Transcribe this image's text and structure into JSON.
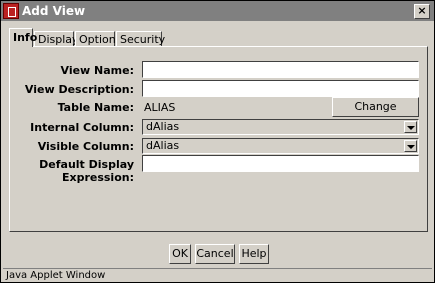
{
  "window": {
    "title": "Add View"
  },
  "tabs": [
    {
      "label": "Info"
    },
    {
      "label": "Display"
    },
    {
      "label": "Options"
    },
    {
      "label": "Security"
    }
  ],
  "form": {
    "view_name_label": "View Name:",
    "view_name_value": "",
    "view_description_label": "View Description:",
    "view_description_value": "",
    "table_name_label": "Table Name:",
    "table_name_value": "ALIAS",
    "change_columns_label": "Change Columns...",
    "internal_column_label": "Internal Column:",
    "internal_column_value": "dAlias",
    "visible_column_label": "Visible Column:",
    "visible_column_value": "dAlias",
    "default_display_label": "Default Display Expression:",
    "default_display_value": ""
  },
  "buttons": {
    "ok": "OK",
    "cancel": "Cancel",
    "help": "Help"
  },
  "status": {
    "text": "Java Applet Window"
  }
}
